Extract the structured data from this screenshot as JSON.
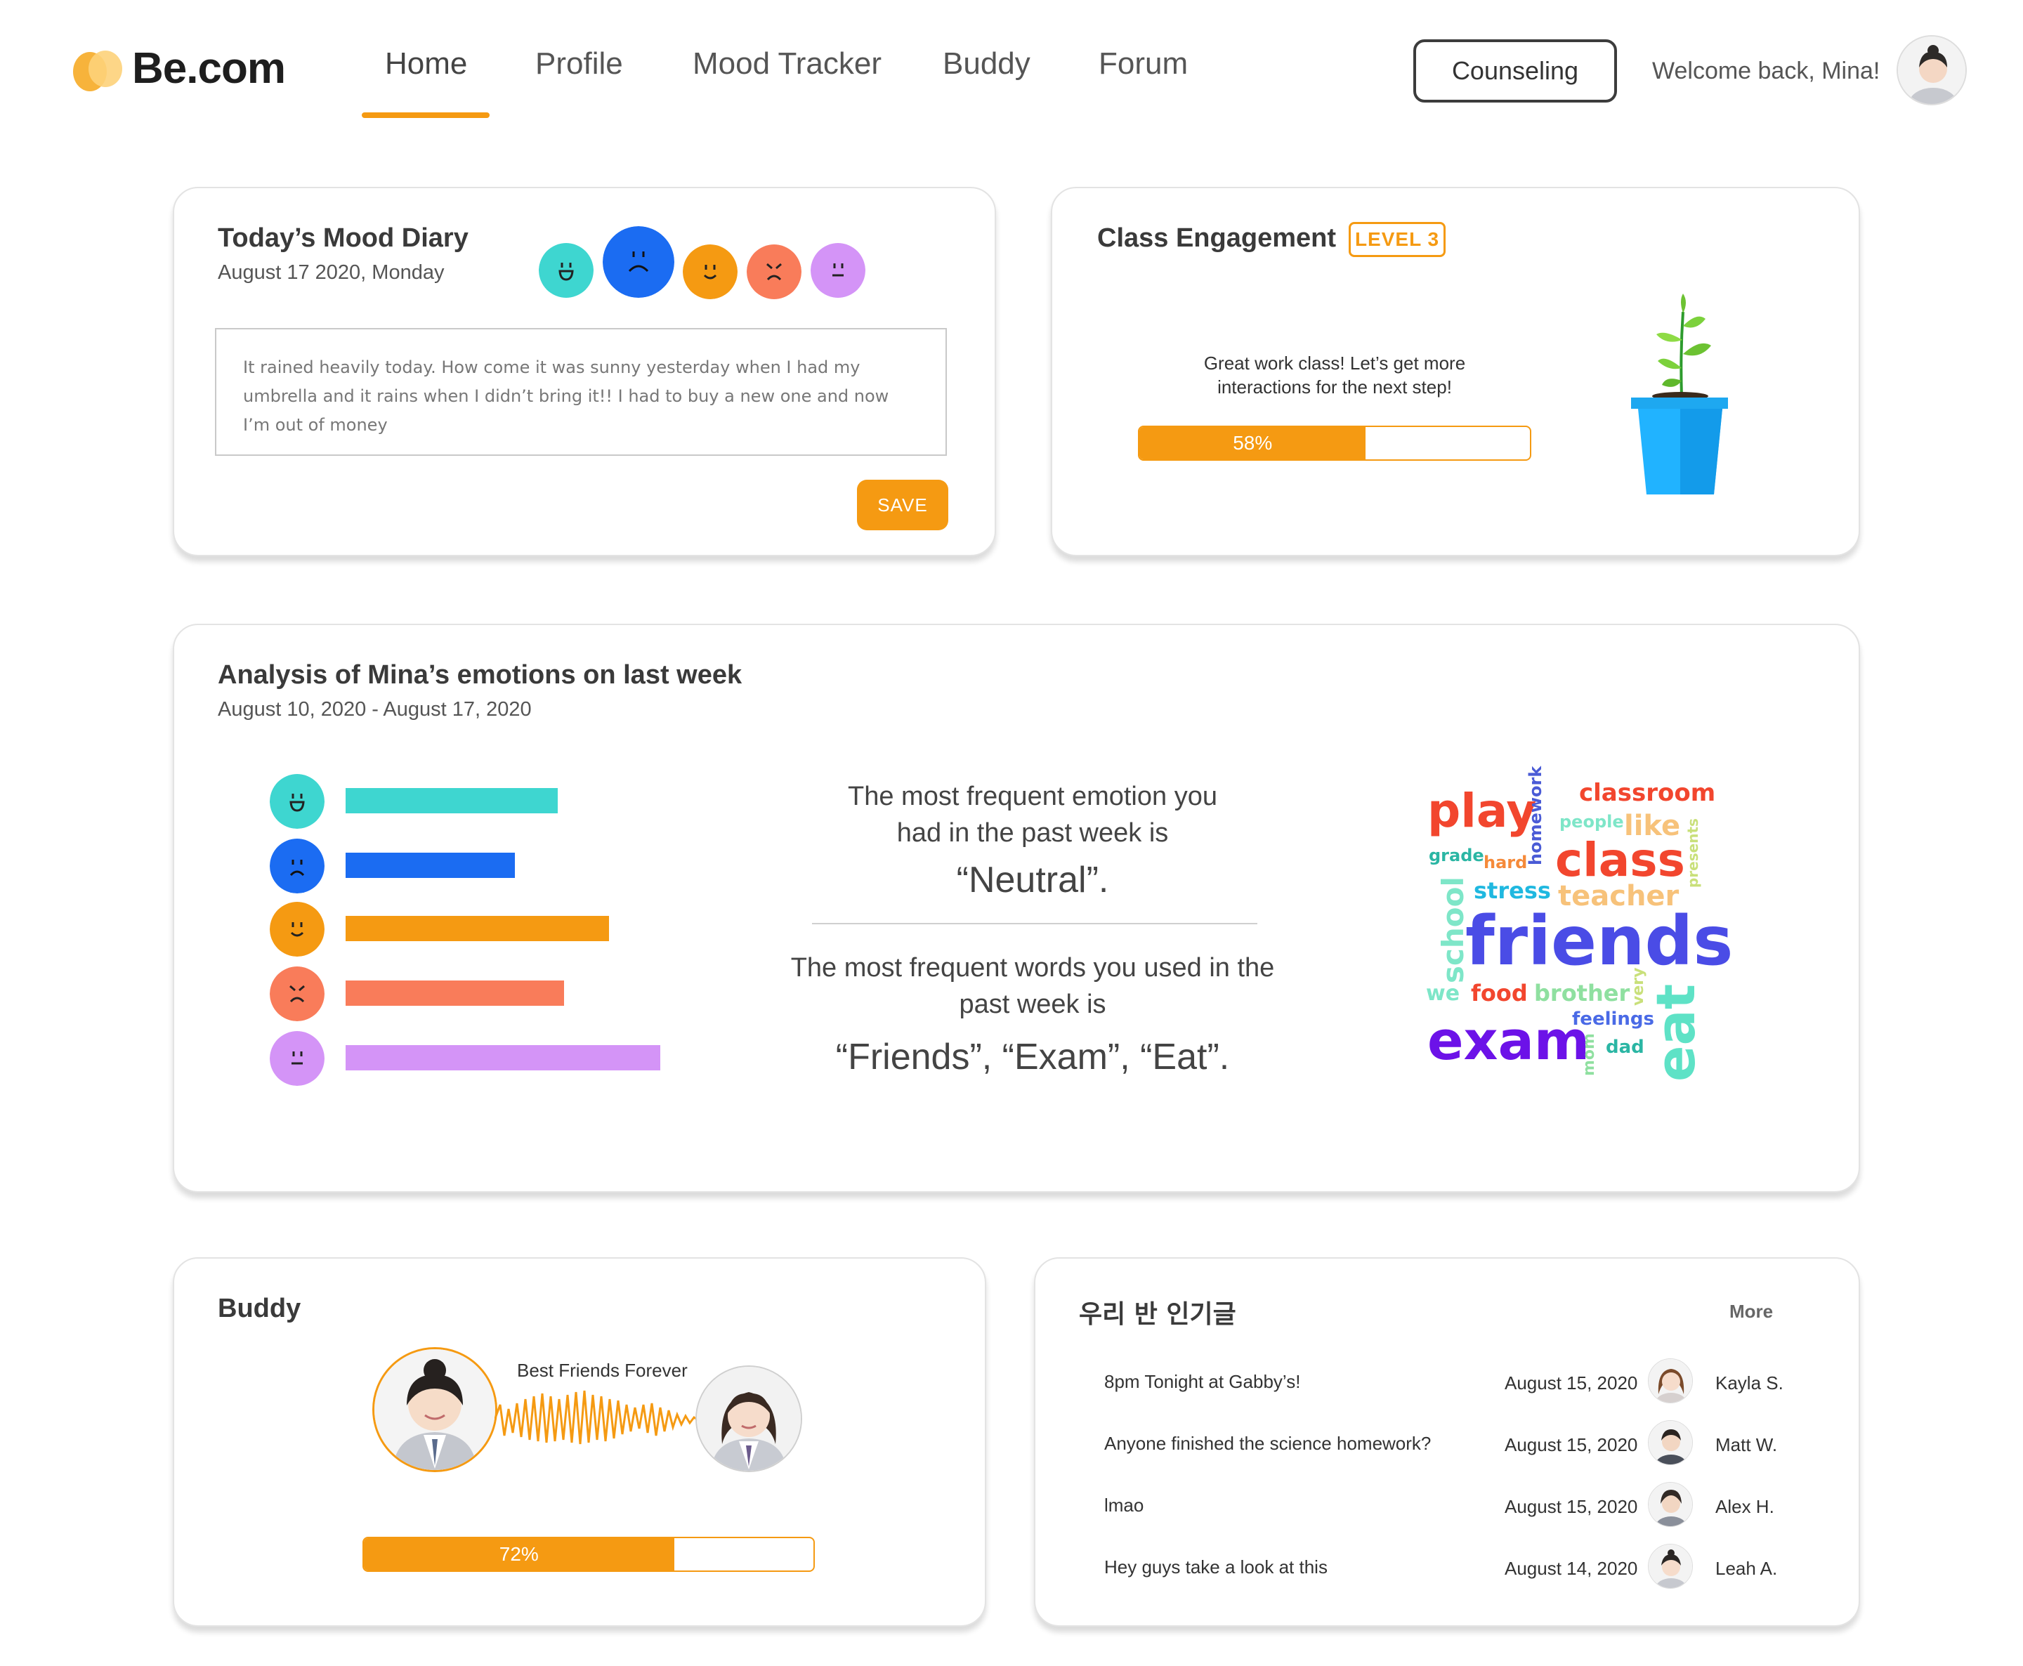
{
  "brand": {
    "name": "Be.com"
  },
  "nav": {
    "items": [
      {
        "label": "Home",
        "active": true
      },
      {
        "label": "Profile"
      },
      {
        "label": "Mood Tracker"
      },
      {
        "label": "Buddy"
      },
      {
        "label": "Forum"
      }
    ],
    "counseling_label": "Counseling",
    "welcome": "Welcome back, Mina!"
  },
  "mood_diary": {
    "title": "Today’s Mood Diary",
    "date": "August 17 2020, Monday",
    "moods": [
      {
        "name": "happy",
        "color": "#3ed6d0"
      },
      {
        "name": "sad",
        "color": "#1b6cf2",
        "selected": true
      },
      {
        "name": "content",
        "color": "#f59a12"
      },
      {
        "name": "angry",
        "color": "#f97c5a"
      },
      {
        "name": "neutral",
        "color": "#d494f7"
      }
    ],
    "entry": "It rained heavily today. How come it was sunny yesterday when I had my umbrella and it rains when I didn’t bring it!! I had to buy a new one and now I’m out of money",
    "save_label": "SAVE"
  },
  "engagement": {
    "title": "Class Engagement",
    "level": "LEVEL 3",
    "message_line1": "Great work class! Let’s get more",
    "message_line2": "interactions for the next step!",
    "progress": 0.58,
    "progress_label": "58%"
  },
  "analysis": {
    "title": "Analysis of Mina’s emotions on last week",
    "range": "August 10, 2020 - August 17, 2020",
    "emotions": [
      {
        "name": "happy",
        "color": "#3ed6d0",
        "value": 0.54
      },
      {
        "name": "sad",
        "color": "#1b6cf2",
        "value": 0.43
      },
      {
        "name": "content",
        "color": "#f59a12",
        "value": 0.67
      },
      {
        "name": "angry",
        "color": "#f97c5a",
        "value": 0.555
      },
      {
        "name": "neutral",
        "color": "#d494f7",
        "value": 0.8
      }
    ],
    "emotion_line1": "The most frequent emotion you",
    "emotion_line2": "had in the past week is",
    "emotion_value": "“Neutral”.",
    "words_line1": "The most frequent words you used in the",
    "words_line2": "past week is",
    "words_value": "“Friends”, “Exam”, “Eat”.",
    "word_cloud": [
      "play",
      "homework",
      "classroom",
      "people",
      "like",
      "presents",
      "grade",
      "hard",
      "class",
      "stress",
      "teacher",
      "school",
      "friends",
      "we",
      "food",
      "brother",
      "very",
      "eat",
      "feelings",
      "exam",
      "mom",
      "dad"
    ]
  },
  "buddy": {
    "title": "Buddy",
    "label": "Best Friends Forever",
    "progress": 0.69,
    "progress_label": "72%"
  },
  "forum": {
    "title": "우리 반 인기글",
    "more_label": "More",
    "posts": [
      {
        "title": "8pm Tonight at Gabby’s!",
        "date": "August 15, 2020",
        "author": "Kayla S."
      },
      {
        "title": "Anyone finished the science homework?",
        "date": "August 15, 2020",
        "author": "Matt W."
      },
      {
        "title": "lmao",
        "date": "August 15, 2020",
        "author": "Alex H."
      },
      {
        "title": "Hey guys take a look at this",
        "date": "August 14, 2020",
        "author": "Leah A."
      }
    ]
  }
}
